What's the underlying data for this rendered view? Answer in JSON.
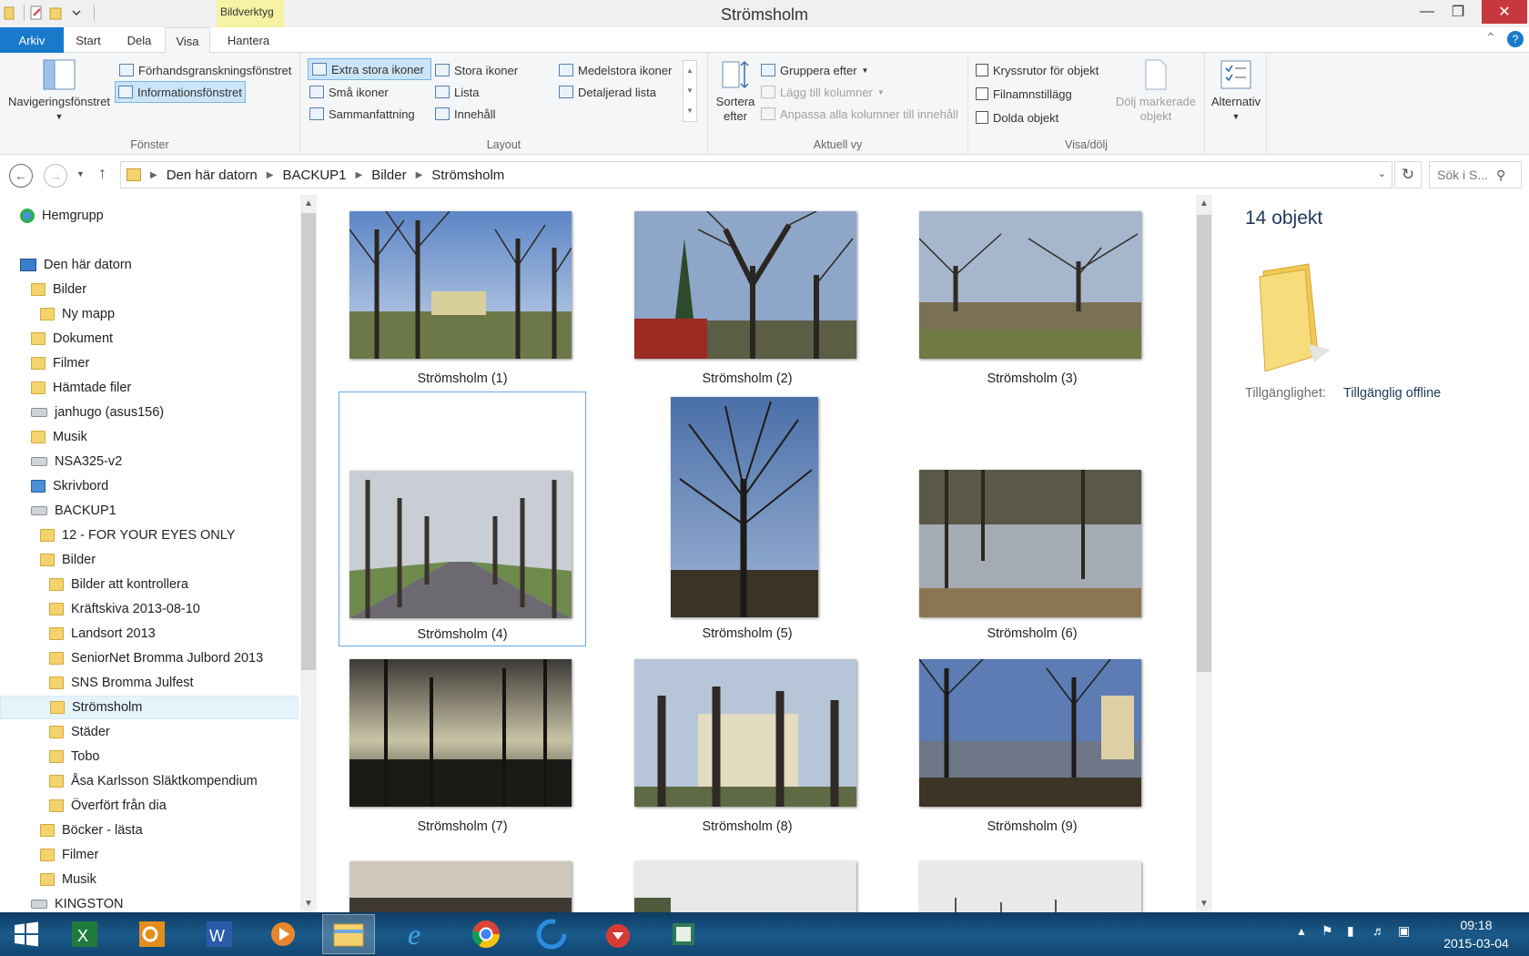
{
  "window": {
    "title": "Strömsholm",
    "context_tab": "Bildverktyg"
  },
  "tabs": [
    {
      "label": "Arkiv"
    },
    {
      "label": "Start"
    },
    {
      "label": "Dela"
    },
    {
      "label": "Visa"
    },
    {
      "label": "Hantera"
    }
  ],
  "ribbon": {
    "fonster": {
      "label": "Fönster",
      "nav_pane": "Navigeringsfönstret",
      "preview_pane": "Förhandsgranskningsfönstret",
      "info_pane": "Informationsfönstret"
    },
    "layout": {
      "label": "Layout",
      "xl_icons": "Extra stora ikoner",
      "large_icons": "Stora ikoner",
      "medium_icons": "Medelstora ikoner",
      "small_icons": "Små ikoner",
      "list": "Lista",
      "details": "Detaljerad lista",
      "tiles": "Sammanfattning",
      "content": "Innehåll"
    },
    "current_view": {
      "label": "Aktuell vy",
      "sort_line1": "Sortera",
      "sort_line2": "efter",
      "group_by": "Gruppera efter",
      "add_columns": "Lägg till kolumner",
      "fit_columns": "Anpassa alla kolumner till innehåll"
    },
    "show_hide": {
      "label": "Visa/dölj",
      "item_checkboxes": "Kryssrutor för objekt",
      "extensions": "Filnamnstillägg",
      "hidden_items": "Dolda objekt",
      "hide_selected_line1": "Dölj markerade",
      "hide_selected_line2": "objekt"
    },
    "options": "Alternativ"
  },
  "address": {
    "crumbs": [
      "Den här datorn",
      "BACKUP1",
      "Bilder",
      "Strömsholm"
    ],
    "search_placeholder": "Sök i S..."
  },
  "nav": {
    "items": [
      {
        "label": "Hemgrupp"
      },
      {
        "label": "Den här datorn"
      },
      {
        "label": "Bilder"
      },
      {
        "label": "Ny mapp"
      },
      {
        "label": "Dokument"
      },
      {
        "label": "Filmer"
      },
      {
        "label": "Hämtade filer"
      },
      {
        "label": "janhugo (asus156)"
      },
      {
        "label": "Musik"
      },
      {
        "label": "NSA325-v2"
      },
      {
        "label": "Skrivbord"
      },
      {
        "label": "BACKUP1"
      },
      {
        "label": "12 - FOR YOUR EYES ONLY"
      },
      {
        "label": "Bilder"
      },
      {
        "label": "Bilder att kontrollera"
      },
      {
        "label": "Kräftskiva 2013-08-10"
      },
      {
        "label": "Landsort 2013"
      },
      {
        "label": "SeniorNet Bromma Julbord 2013"
      },
      {
        "label": "SNS Bromma Julfest"
      },
      {
        "label": "Strömsholm"
      },
      {
        "label": "Städer"
      },
      {
        "label": "Tobo"
      },
      {
        "label": "Åsa Karlsson Släktkompendium"
      },
      {
        "label": "Överfört från dia"
      },
      {
        "label": "Böcker - lästa"
      },
      {
        "label": "Filmer"
      },
      {
        "label": "Musik"
      },
      {
        "label": "KINGSTON"
      }
    ]
  },
  "files": [
    {
      "name": "Strömsholm (1)"
    },
    {
      "name": "Strömsholm (2)"
    },
    {
      "name": "Strömsholm (3)"
    },
    {
      "name": "Strömsholm (4)"
    },
    {
      "name": "Strömsholm (5)"
    },
    {
      "name": "Strömsholm (6)"
    },
    {
      "name": "Strömsholm (7)"
    },
    {
      "name": "Strömsholm (8)"
    },
    {
      "name": "Strömsholm (9)"
    }
  ],
  "details": {
    "count": "14 objekt",
    "availability_label": "Tillgänglighet:",
    "availability_value": "Tillgänglig offline"
  },
  "taskbar": {
    "time": "09:18",
    "date": "2015-03-04",
    "apps": [
      "start-icon",
      "excel-icon",
      "outlook-icon",
      "word-icon",
      "media-player-icon",
      "file-explorer-icon",
      "internet-explorer-icon",
      "chrome-icon",
      "ccleaner-icon",
      "downloader-icon",
      "reader-icon"
    ]
  },
  "colors": {
    "file_tab": "#1979ca",
    "selection": "#cce4f7",
    "context_tab": "#f6f3a4",
    "taskbar": "#1a5a8a"
  }
}
